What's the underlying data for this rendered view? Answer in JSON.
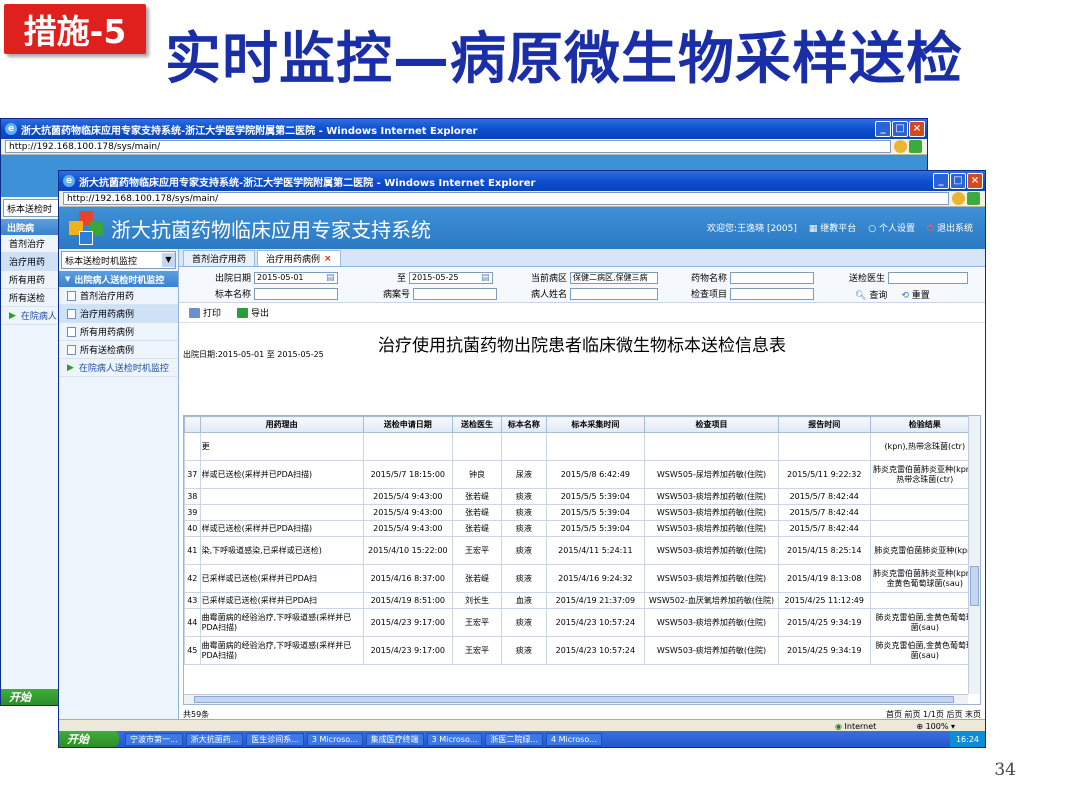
{
  "slide": {
    "badge": "措施-5",
    "title": "实时监控—病原微生物采样送检",
    "page_number": "34"
  },
  "back_window": {
    "title": "浙大抗菌药物临床应用专家支持系统-浙江大学医学院附属第二医院 - Windows Internet Explorer",
    "url": "http://192.168.100.178/sys/main/",
    "sidebar_select": "标本送检时",
    "sidebar_items": [
      "出院病",
      "首剂治疗",
      "治疗用药",
      "所有用药",
      "所有送检",
      "在院病人"
    ],
    "start_label": "开始"
  },
  "window": {
    "title": "浙大抗菌药物临床应用专家支持系统-浙江大学医学院附属第二医院 - Windows Internet Explorer",
    "url": "http://192.168.100.178/sys/main/"
  },
  "app": {
    "name": "浙大抗菌药物临床应用专家支持系统",
    "welcome": "欢迎您:王逸晓 [2005]",
    "nav": [
      "继教平台",
      "个人设置",
      "退出系统"
    ]
  },
  "sidebar": {
    "select_value": "标本送检时机监控",
    "section_header": "出院病人送检时机监控",
    "items": [
      "首剂治疗用药",
      "治疗用药病例",
      "所有用药病例",
      "所有送检病例"
    ],
    "group": "在院病人送检时机监控"
  },
  "tabs": [
    {
      "label": "首剂治疗用药",
      "active": false
    },
    {
      "label": "治疗用药病例",
      "active": true
    }
  ],
  "tab_close": "×",
  "filters": {
    "discharge_date_label": "出院日期",
    "date_from": "2015-05-01",
    "to_label": "至",
    "date_to": "2015-05-25",
    "ward_label": "当前病区",
    "ward_value": "保健二病区,保健三病",
    "drug_label": "药物名称",
    "doctor_label": "送检医生",
    "specimen_label": "标本名称",
    "record_label": "病案号",
    "patient_label": "病人姓名",
    "exam_label": "检查项目",
    "query_button": "查询",
    "reset_button": "重置"
  },
  "toolbar": {
    "print": "打印",
    "export": "导出"
  },
  "report": {
    "title": "治疗使用抗菌药物出院患者临床微生物标本送检信息表",
    "date_range": "出院日期:2015-05-01 至 2015-05-25",
    "columns": [
      "",
      "用药理由",
      "送检申请日期",
      "送检医生",
      "标本名称",
      "标本采集时间",
      "检查项目",
      "报告时间",
      "检验结果"
    ],
    "rows": [
      {
        "no": "",
        "reason": "更",
        "apply_date": "",
        "doctor": "",
        "specimen": "",
        "collect_time": "",
        "exam": "",
        "report_time": "",
        "result": "(kpn),热带念珠菌(ctr)"
      },
      {
        "no": "37",
        "reason": "样或已送检(采样并已PDA扫描)",
        "apply_date": "2015/5/7 18:15:00",
        "doctor": "钟良",
        "specimen": "尿液",
        "collect_time": "2015/5/8 6:42:49",
        "exam": "WSW505-尿培养加药敏(住院)",
        "report_time": "2015/5/11 9:22:32",
        "result": "肺炎克雷伯菌肺炎亚种(kpn),热带念珠菌(ctr)"
      },
      {
        "no": "38",
        "reason": "",
        "apply_date": "2015/5/4 9:43:00",
        "doctor": "张若缇",
        "specimen": "痰液",
        "collect_time": "2015/5/5 5:39:04",
        "exam": "WSW503-痰培养加药敏(住院)",
        "report_time": "2015/5/7 8:42:44",
        "result": ""
      },
      {
        "no": "39",
        "reason": "",
        "apply_date": "2015/5/4 9:43:00",
        "doctor": "张若缇",
        "specimen": "痰液",
        "collect_time": "2015/5/5 5:39:04",
        "exam": "WSW503-痰培养加药敏(住院)",
        "report_time": "2015/5/7 8:42:44",
        "result": ""
      },
      {
        "no": "40",
        "reason": "样或已送检(采样并已PDA扫描)",
        "apply_date": "2015/5/4 9:43:00",
        "doctor": "张若缇",
        "specimen": "痰液",
        "collect_time": "2015/5/5 5:39:04",
        "exam": "WSW503-痰培养加药敏(住院)",
        "report_time": "2015/5/7 8:42:44",
        "result": ""
      },
      {
        "no": "41",
        "reason": "染,下呼吸道感染,已采样或已送检)",
        "apply_date": "2015/4/10 15:22:00",
        "doctor": "王宏平",
        "specimen": "痰液",
        "collect_time": "2015/4/11 5:24:11",
        "exam": "WSW503-痰培养加药敏(住院)",
        "report_time": "2015/4/15 8:25:14",
        "result": "肺炎克雷伯菌肺炎亚种(kpn)"
      },
      {
        "no": "42",
        "reason": "已采样或已送检(采样并已PDA扫",
        "apply_date": "2015/4/16 8:37:00",
        "doctor": "张若缇",
        "specimen": "痰液",
        "collect_time": "2015/4/16 9:24:32",
        "exam": "WSW503-痰培养加药敏(住院)",
        "report_time": "2015/4/19 8:13:08",
        "result": "肺炎克雷伯菌肺炎亚种(kpn),金黄色葡萄球菌(sau)"
      },
      {
        "no": "43",
        "reason": "已采样或已送检(采样并已PDA扫",
        "apply_date": "2015/4/19 8:51:00",
        "doctor": "刘长生",
        "specimen": "血液",
        "collect_time": "2015/4/19 21:37:09",
        "exam": "WSW502-血厌氧培养加药敏(住院)",
        "report_time": "2015/4/25 11:12:49",
        "result": ""
      },
      {
        "no": "44",
        "reason": "曲霉菌病的经验治疗,下呼吸道感(采样并已PDA扫描)",
        "apply_date": "2015/4/23 9:17:00",
        "doctor": "王宏平",
        "specimen": "痰液",
        "collect_time": "2015/4/23 10:57:24",
        "exam": "WSW503-痰培养加药敏(住院)",
        "report_time": "2015/4/25 9:34:19",
        "result": "肺炎克雷伯菌,金黄色葡萄球菌(sau)"
      },
      {
        "no": "45",
        "reason": "曲霉菌病的经验治疗,下呼吸道感(采样并已PDA扫描)",
        "apply_date": "2015/4/23 9:17:00",
        "doctor": "王宏平",
        "specimen": "痰液",
        "collect_time": "2015/4/23 10:57:24",
        "exam": "WSW503-痰培养加药敏(住院)",
        "report_time": "2015/4/25 9:34:19",
        "result": "肺炎克雷伯菌,金黄色葡萄球菌(sau)"
      }
    ],
    "total": "共59条",
    "pager": "首页 前页 1/1页 后页 末页"
  },
  "statusbar": {
    "zone": "Internet",
    "zoom": "100%"
  },
  "taskbar": {
    "start": "开始",
    "tasks": [
      "宁波市第一...",
      "浙大抗菌药...",
      "医生诊间系...",
      "3 Microso...",
      "集成医疗终端",
      "3 Microso...",
      "浙医二院绿...",
      "4 Microso..."
    ],
    "clock": "16:24"
  },
  "colors": {
    "badge": "#e0201c",
    "slide_title": "#1a2ea8",
    "app_header": "#3d91d6",
    "titlebar": "#0d4fcf"
  }
}
